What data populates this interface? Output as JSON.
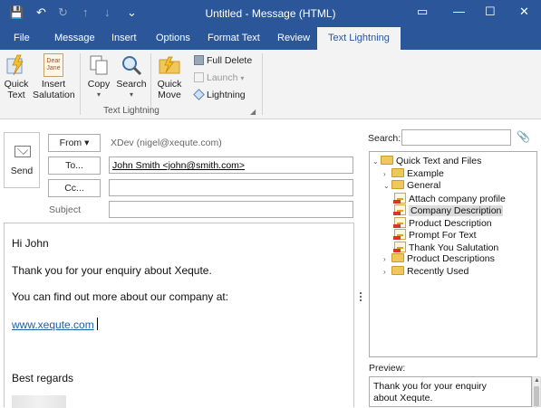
{
  "window": {
    "title": "Untitled - Message (HTML)",
    "controls": {
      "restore": "▭",
      "minimize": "—",
      "maximize": "☐",
      "close": "✕"
    }
  },
  "quick_access": {
    "save": "💾",
    "undo": "↶",
    "redo": "↻",
    "up": "↑",
    "down": "↓",
    "more": "⌄"
  },
  "tabs": [
    {
      "label": "File"
    },
    {
      "label": "Message"
    },
    {
      "label": "Insert"
    },
    {
      "label": "Options"
    },
    {
      "label": "Format Text"
    },
    {
      "label": "Review"
    },
    {
      "label": "Text Lightning",
      "active": true
    }
  ],
  "ribbon": {
    "quick_text": "Quick\nText",
    "insert_salutation": "Insert\nSalutation",
    "salutation_icon_text": "Dear\nJane",
    "copy": "Copy",
    "search": "Search",
    "quick_move": "Quick\nMove",
    "full_delete": "Full Delete",
    "launch": "Launch",
    "lightning": "Lightning",
    "group_label": "Text Lightning",
    "dropdown_marks": "▾"
  },
  "header": {
    "send": "Send",
    "from_label": "From ▾",
    "from_value": "XDev (nigel@xequte.com)",
    "to_label": "To...",
    "to_value": "John Smith <john@smith.com>",
    "cc_label": "Cc...",
    "cc_value": "",
    "subject_label": "Subject",
    "subject_value": ""
  },
  "body": {
    "greeting": "Hi John",
    "line1": "Thank you for your enquiry about Xequte.",
    "line2": "You can find out more about our company at:",
    "link": "www.xequte.com",
    "closing": "Best regards"
  },
  "pane": {
    "search_label": "Search:",
    "search_value": "",
    "preview_label": "Preview:",
    "preview_text": "Thank you for your enquiry about Xequte.",
    "tree": [
      {
        "label": "Quick Text and Files",
        "kind": "folder",
        "depth": 0,
        "toggle": "⌄"
      },
      {
        "label": "Example",
        "kind": "folder",
        "depth": 1,
        "toggle": "›"
      },
      {
        "label": "General",
        "kind": "folder",
        "depth": 1,
        "toggle": "⌄"
      },
      {
        "label": "Attach company profile",
        "kind": "item",
        "depth": 2
      },
      {
        "label": "Company Description",
        "kind": "item",
        "depth": 2,
        "selected": true
      },
      {
        "label": "Product Description",
        "kind": "item",
        "depth": 2
      },
      {
        "label": "Prompt For Text",
        "kind": "item",
        "depth": 2
      },
      {
        "label": "Thank You Salutation",
        "kind": "item",
        "depth": 2
      },
      {
        "label": "Product Descriptions",
        "kind": "folder",
        "depth": 1,
        "toggle": "›"
      },
      {
        "label": "Recently Used",
        "kind": "folder",
        "depth": 1,
        "toggle": "›"
      }
    ]
  },
  "colors": {
    "accent": "#2b579a",
    "link": "#1f5ea8",
    "folder": "#f1c75b"
  }
}
